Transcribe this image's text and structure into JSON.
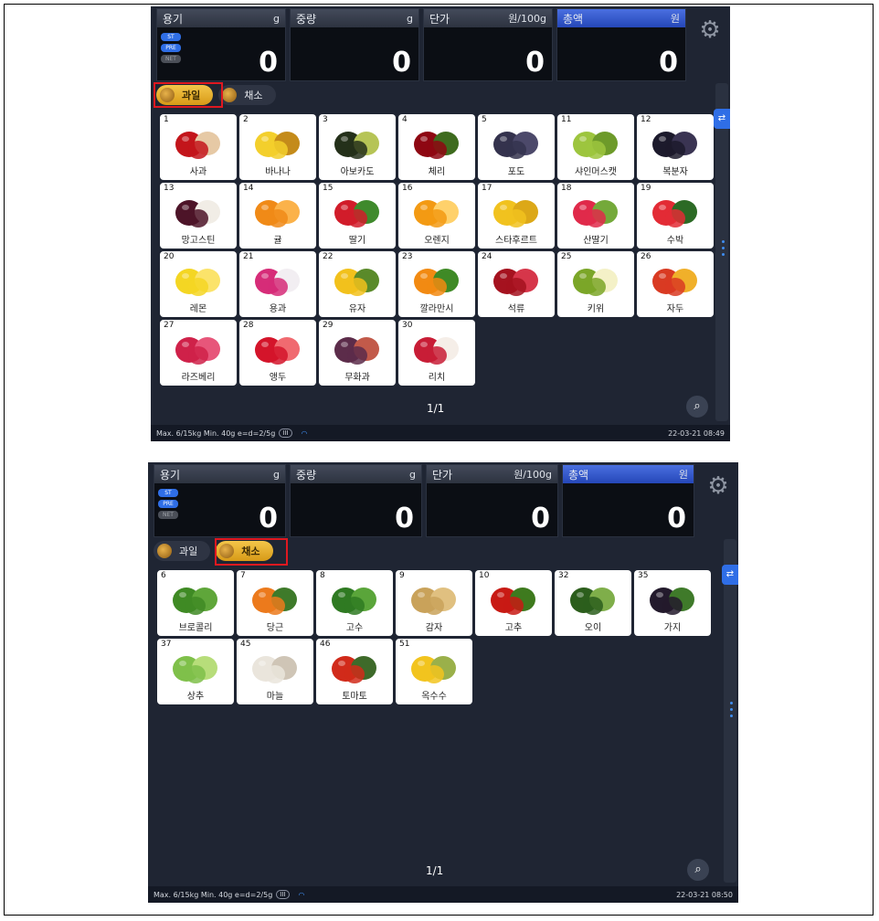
{
  "screens": [
    {
      "readouts": [
        {
          "label": "용기",
          "unit": "g",
          "value": "0"
        },
        {
          "label": "중량",
          "unit": "g",
          "value": "0"
        },
        {
          "label": "단가",
          "unit": "원/100g",
          "value": "0"
        },
        {
          "label": "총액",
          "unit": "원",
          "value": "0"
        }
      ],
      "flags": [
        "ST",
        "PRE",
        "NET"
      ],
      "tabs": [
        {
          "label": "과일",
          "active": true
        },
        {
          "label": "채소",
          "active": false
        }
      ],
      "items": [
        {
          "num": "1",
          "name": "사과",
          "colors": [
            "#c3151b",
            "#e6c9a5"
          ]
        },
        {
          "num": "2",
          "name": "바나나",
          "colors": [
            "#f3cf2c",
            "#c48b1a"
          ]
        },
        {
          "num": "3",
          "name": "아보카도",
          "colors": [
            "#24301a",
            "#b6c456"
          ]
        },
        {
          "num": "4",
          "name": "체리",
          "colors": [
            "#8e0712",
            "#3e6b1e"
          ]
        },
        {
          "num": "5",
          "name": "포도",
          "colors": [
            "#34324d",
            "#4c496a"
          ]
        },
        {
          "num": "11",
          "name": "샤인머스캣",
          "colors": [
            "#9dc53e",
            "#6d9a2a"
          ]
        },
        {
          "num": "12",
          "name": "복분자",
          "colors": [
            "#1c1a2c",
            "#3a3452"
          ]
        },
        {
          "num": "13",
          "name": "망고스틴",
          "colors": [
            "#4d1428",
            "#f1ede6"
          ]
        },
        {
          "num": "14",
          "name": "귤",
          "colors": [
            "#f08a17",
            "#fbb24a"
          ]
        },
        {
          "num": "15",
          "name": "딸기",
          "colors": [
            "#d11c2a",
            "#3f8a2c"
          ]
        },
        {
          "num": "16",
          "name": "오렌지",
          "colors": [
            "#f39a13",
            "#ffd16b"
          ]
        },
        {
          "num": "17",
          "name": "스타후르트",
          "colors": [
            "#f1c21f",
            "#dca818"
          ]
        },
        {
          "num": "18",
          "name": "산딸기",
          "colors": [
            "#e02a4a",
            "#74a93a"
          ]
        },
        {
          "num": "19",
          "name": "수박",
          "colors": [
            "#e32b35",
            "#2c6a25"
          ]
        },
        {
          "num": "20",
          "name": "레몬",
          "colors": [
            "#f4d623",
            "#fbe36a"
          ]
        },
        {
          "num": "21",
          "name": "용과",
          "colors": [
            "#d62c78",
            "#f2eef2"
          ]
        },
        {
          "num": "22",
          "name": "유자",
          "colors": [
            "#f2c11c",
            "#5a8a2a"
          ]
        },
        {
          "num": "23",
          "name": "깔라만시",
          "colors": [
            "#f28a12",
            "#3f8a26"
          ]
        },
        {
          "num": "24",
          "name": "석류",
          "colors": [
            "#a5121f",
            "#d6364a"
          ]
        },
        {
          "num": "25",
          "name": "키위",
          "colors": [
            "#7ba628",
            "#f4f1c7"
          ]
        },
        {
          "num": "26",
          "name": "자두",
          "colors": [
            "#d93a22",
            "#f0b02a"
          ]
        },
        {
          "num": "27",
          "name": "라즈베리",
          "colors": [
            "#cf2149",
            "#e7567a"
          ]
        },
        {
          "num": "28",
          "name": "앵두",
          "colors": [
            "#d4142a",
            "#f06a70"
          ]
        },
        {
          "num": "29",
          "name": "무화과",
          "colors": [
            "#5c2c4a",
            "#c25a4a"
          ]
        },
        {
          "num": "30",
          "name": "리치",
          "colors": [
            "#c81d36",
            "#f5eee8"
          ]
        }
      ],
      "pager": "1/1",
      "status": {
        "left": "Max. 6/15kg  Min. 40g  e=d=2/5g",
        "badge": "III",
        "time": "22-03-21 08:49"
      }
    },
    {
      "readouts": [
        {
          "label": "용기",
          "unit": "g",
          "value": "0"
        },
        {
          "label": "중량",
          "unit": "g",
          "value": "0"
        },
        {
          "label": "단가",
          "unit": "원/100g",
          "value": "0"
        },
        {
          "label": "총액",
          "unit": "원",
          "value": "0"
        }
      ],
      "flags": [
        "ST",
        "PRE",
        "NET"
      ],
      "tabs": [
        {
          "label": "과일",
          "active": false
        },
        {
          "label": "채소",
          "active": true
        }
      ],
      "items": [
        {
          "num": "6",
          "name": "브로콜리",
          "colors": [
            "#3f8a24",
            "#5fa63a"
          ]
        },
        {
          "num": "7",
          "name": "당근",
          "colors": [
            "#ec7a1c",
            "#3e7a2a"
          ]
        },
        {
          "num": "8",
          "name": "고수",
          "colors": [
            "#2f7a22",
            "#5aa53a"
          ]
        },
        {
          "num": "9",
          "name": "감자",
          "colors": [
            "#c9a25a",
            "#e0c080"
          ]
        },
        {
          "num": "10",
          "name": "고추",
          "colors": [
            "#c81a14",
            "#3e7a1e"
          ]
        },
        {
          "num": "32",
          "name": "오이",
          "colors": [
            "#2c5e1c",
            "#7fae4a"
          ]
        },
        {
          "num": "35",
          "name": "가지",
          "colors": [
            "#231a2c",
            "#3f7a2a"
          ]
        },
        {
          "num": "37",
          "name": "상추",
          "colors": [
            "#7fc04a",
            "#b7dd7a"
          ]
        },
        {
          "num": "45",
          "name": "마늘",
          "colors": [
            "#eae5dc",
            "#cfc5b6"
          ]
        },
        {
          "num": "46",
          "name": "토마토",
          "colors": [
            "#d12a1a",
            "#3e6a2a"
          ]
        },
        {
          "num": "51",
          "name": "옥수수",
          "colors": [
            "#f2c41e",
            "#9ab04a"
          ]
        }
      ],
      "pager": "1/1",
      "status": {
        "left": "Max. 6/15kg  Min. 40g  e=d=2/5g",
        "badge": "III",
        "time": "22-03-21 08:50"
      }
    }
  ],
  "icons": {
    "gear": "gear-icon",
    "search": "search-icon",
    "wifi": "wifi-icon"
  }
}
